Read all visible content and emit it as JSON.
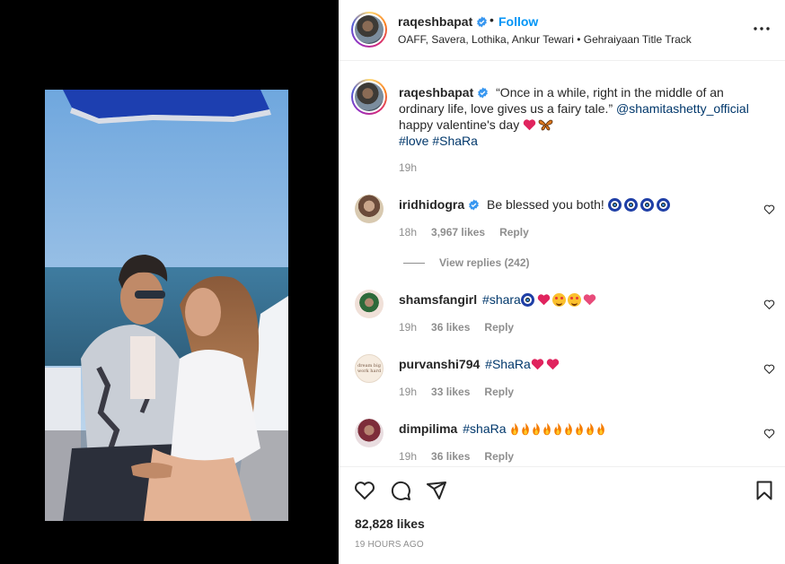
{
  "header": {
    "username": "raqeshbapat",
    "separator": "•",
    "follow_label": "Follow",
    "audio_line": "OAFF, Savera, Lothika, Ankur Tewari • Gehraiyaan Title Track"
  },
  "caption": {
    "username": "raqeshbapat",
    "text": "“Once in a while, right in the middle of an ordinary life, love gives us a fairy tale.” ",
    "mention": "@shamitashetty_official",
    "text_after": " happy valentine's day ",
    "hashtag_1": "#love",
    "hashtag_2": "#ShaRa",
    "time": "19h"
  },
  "comments": [
    {
      "username": "iridhidogra",
      "text": "Be blessed you both! ",
      "time": "18h",
      "likes": "3,967 likes",
      "reply": "Reply",
      "view_replies": "View replies (242)"
    },
    {
      "username": "shamsfangirl",
      "hashtag": "#shara",
      "time": "19h",
      "likes": "36 likes",
      "reply": "Reply"
    },
    {
      "username": "purvanshi794",
      "hashtag": "#ShaRa",
      "avatar_text": "dream big work hard",
      "time": "19h",
      "likes": "33 likes",
      "reply": "Reply"
    },
    {
      "username": "dimpilima",
      "hashtag": "#shaRa",
      "time": "19h",
      "likes": "36 likes",
      "reply": "Reply"
    }
  ],
  "footer": {
    "likes_total": "82,828 likes",
    "posted_ago": "19 HOURS AGO"
  },
  "icons": [
    "verified-badge-icon",
    "more-options-icon",
    "heart-icon",
    "comment-icon",
    "share-icon",
    "bookmark-icon"
  ],
  "colors": {
    "accent": "#0095f6",
    "link": "#00376b",
    "muted": "#8e8e8e",
    "verified": "#3897f0",
    "emoji_heart": "#e0245e"
  }
}
